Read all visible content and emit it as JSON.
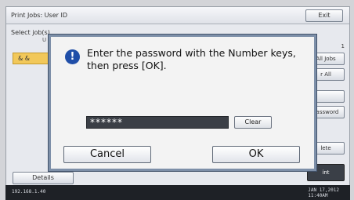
{
  "app": {
    "title": "Print Jobs: User ID",
    "exit_label": "Exit",
    "select_label": "Select job(s).",
    "column_head": "U",
    "count": "1",
    "job_row_label": "& &",
    "side_buttons": [
      "All Jobs",
      "r All",
      "",
      "Password",
      "lete",
      "int"
    ],
    "details_label": "Details"
  },
  "status": {
    "ip": "192.168.1.40",
    "date_line1": "JAN  17,2012",
    "date_line2": "11:40AM"
  },
  "dialog": {
    "icon": "info-icon",
    "message_line1": "Enter the password with the Number keys,",
    "message_line2": "then press [OK].",
    "password_value": "******",
    "clear_label": "Clear",
    "cancel_label": "Cancel",
    "ok_label": "OK"
  }
}
